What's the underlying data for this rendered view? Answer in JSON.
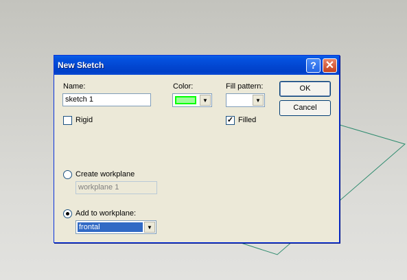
{
  "dialog": {
    "title": "New Sketch",
    "help_glyph": "?",
    "close_glyph": "✕"
  },
  "form": {
    "name_label": "Name:",
    "name_value": "sketch 1",
    "color_label": "Color:",
    "color_value": "#9dfc98",
    "fill_pattern_label": "Fill pattern:",
    "fill_pattern_value": "",
    "rigid_label": "Rigid",
    "rigid_checked": false,
    "filled_label": "Filled",
    "filled_checked": true,
    "create_workplane_label": "Create workplane",
    "create_workplane_value": "workplane 1",
    "add_to_workplane_label": "Add to workplane:",
    "add_to_workplane_value": "frontal"
  },
  "buttons": {
    "ok": "OK",
    "cancel": "Cancel"
  },
  "glyphs": {
    "check": "✓",
    "dropdown": "▼"
  },
  "colors": {
    "titlebar": "#0245cf",
    "dialog_bg": "#ece9d8",
    "selection": "#316ac5",
    "workplane_line": "#2e8b6e"
  }
}
